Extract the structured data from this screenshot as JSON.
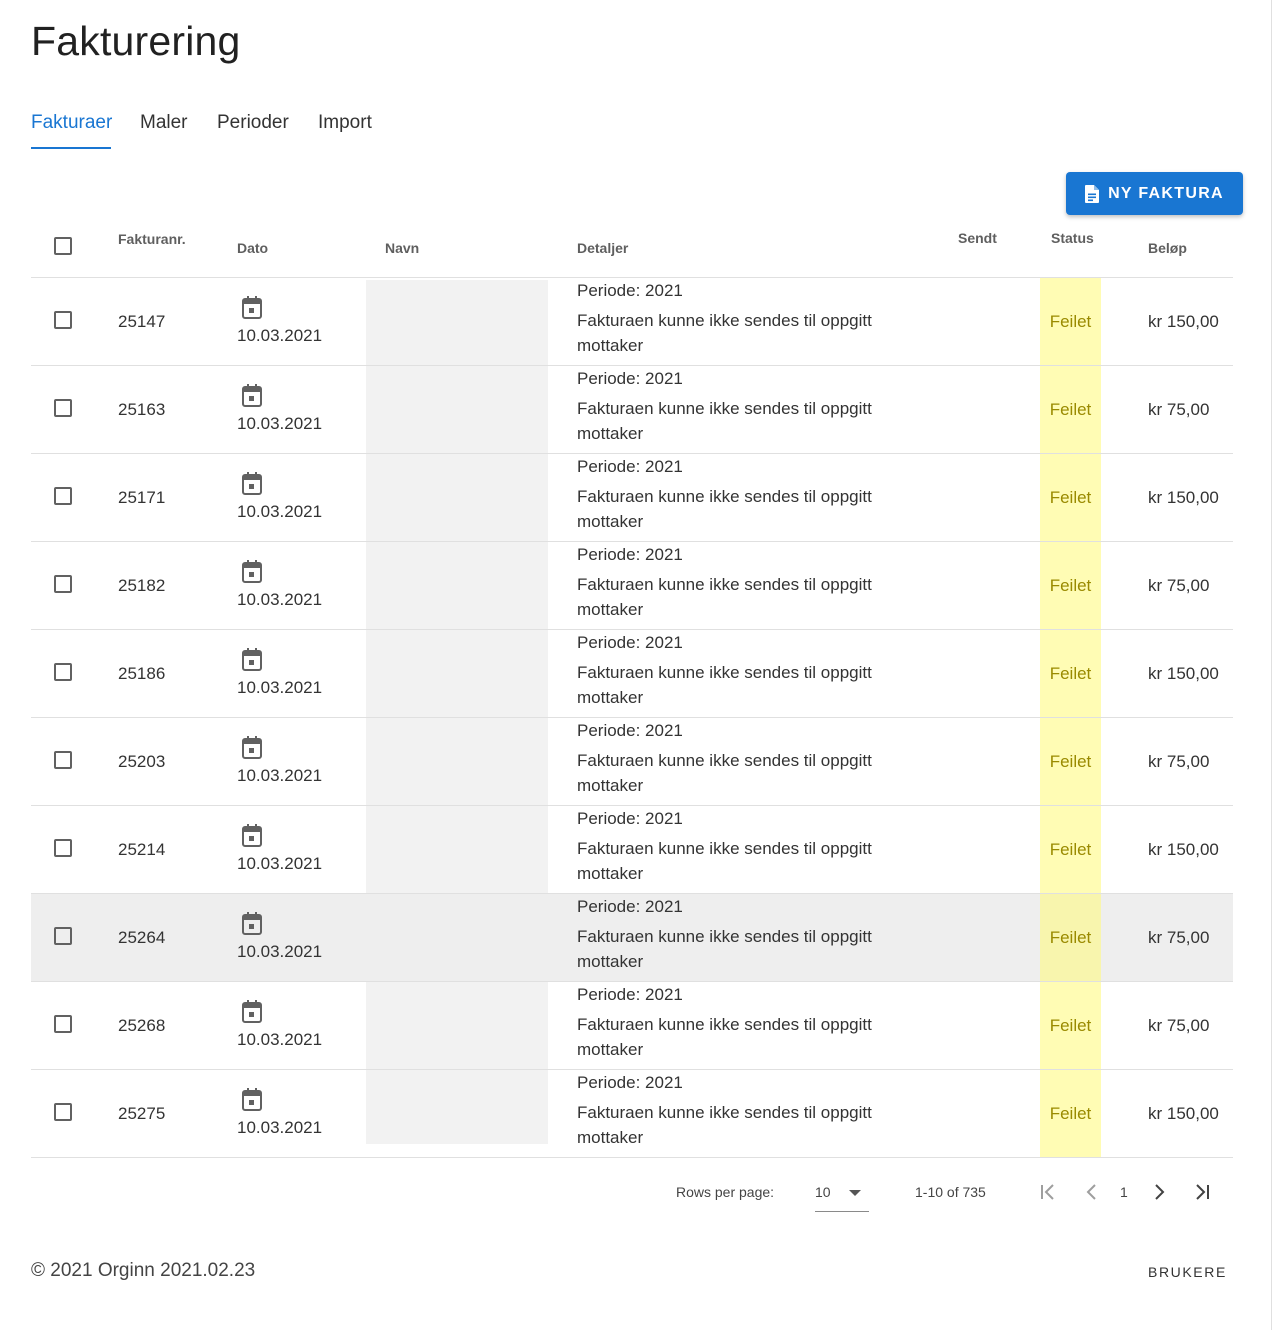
{
  "page": {
    "title": "Fakturering"
  },
  "tabs": [
    {
      "label": "Fakturaer",
      "active": true
    },
    {
      "label": "Maler"
    },
    {
      "label": "Perioder"
    },
    {
      "label": "Import"
    }
  ],
  "toolbar": {
    "new_invoice_label": "NY FAKTURA",
    "new_invoice_icon": "document-icon"
  },
  "table": {
    "columns": [
      "Fakturanr.",
      "Dato",
      "Navn",
      "Detaljer",
      "Sendt",
      "Status",
      "Beløp"
    ],
    "rows": [
      {
        "nr": "25147",
        "date": "10.03.2021",
        "period": "Periode: 2021",
        "message": "Fakturaen kunne ikke sendes til oppgitt mottaker",
        "status": "Feilet",
        "amount": "kr 150,00"
      },
      {
        "nr": "25163",
        "date": "10.03.2021",
        "period": "Periode: 2021",
        "message": "Fakturaen kunne ikke sendes til oppgitt mottaker",
        "status": "Feilet",
        "amount": "kr 75,00"
      },
      {
        "nr": "25171",
        "date": "10.03.2021",
        "period": "Periode: 2021",
        "message": "Fakturaen kunne ikke sendes til oppgitt mottaker",
        "status": "Feilet",
        "amount": "kr 150,00"
      },
      {
        "nr": "25182",
        "date": "10.03.2021",
        "period": "Periode: 2021",
        "message": "Fakturaen kunne ikke sendes til oppgitt mottaker",
        "status": "Feilet",
        "amount": "kr 75,00"
      },
      {
        "nr": "25186",
        "date": "10.03.2021",
        "period": "Periode: 2021",
        "message": "Fakturaen kunne ikke sendes til oppgitt mottaker",
        "status": "Feilet",
        "amount": "kr 150,00"
      },
      {
        "nr": "25203",
        "date": "10.03.2021",
        "period": "Periode: 2021",
        "message": "Fakturaen kunne ikke sendes til oppgitt mottaker",
        "status": "Feilet",
        "amount": "kr 75,00"
      },
      {
        "nr": "25214",
        "date": "10.03.2021",
        "period": "Periode: 2021",
        "message": "Fakturaen kunne ikke sendes til oppgitt mottaker",
        "status": "Feilet",
        "amount": "kr 150,00"
      },
      {
        "nr": "25264",
        "date": "10.03.2021",
        "period": "Periode: 2021",
        "message": "Fakturaen kunne ikke sendes til oppgitt mottaker",
        "status": "Feilet",
        "amount": "kr 75,00",
        "highlighted": true
      },
      {
        "nr": "25268",
        "date": "10.03.2021",
        "period": "Periode: 2021",
        "message": "Fakturaen kunne ikke sendes til oppgitt mottaker",
        "status": "Feilet",
        "amount": "kr 75,00"
      },
      {
        "nr": "25275",
        "date": "10.03.2021",
        "period": "Periode: 2021",
        "message": "Fakturaen kunne ikke sendes til oppgitt mottaker",
        "status": "Feilet",
        "amount": "kr 150,00"
      }
    ]
  },
  "pagination": {
    "rows_per_page_label": "Rows per page:",
    "rows_per_page": "10",
    "range": "1-10 of 735",
    "page": "1"
  },
  "footer": {
    "copyright": "© 2021 Orginn 2021.02.23",
    "link": "BRUKERE"
  },
  "colors": {
    "accent": "#1976d2",
    "status_bg": "#fff9a8",
    "status_text": "#9a8a00",
    "row_highlight": "#eeeeee"
  }
}
